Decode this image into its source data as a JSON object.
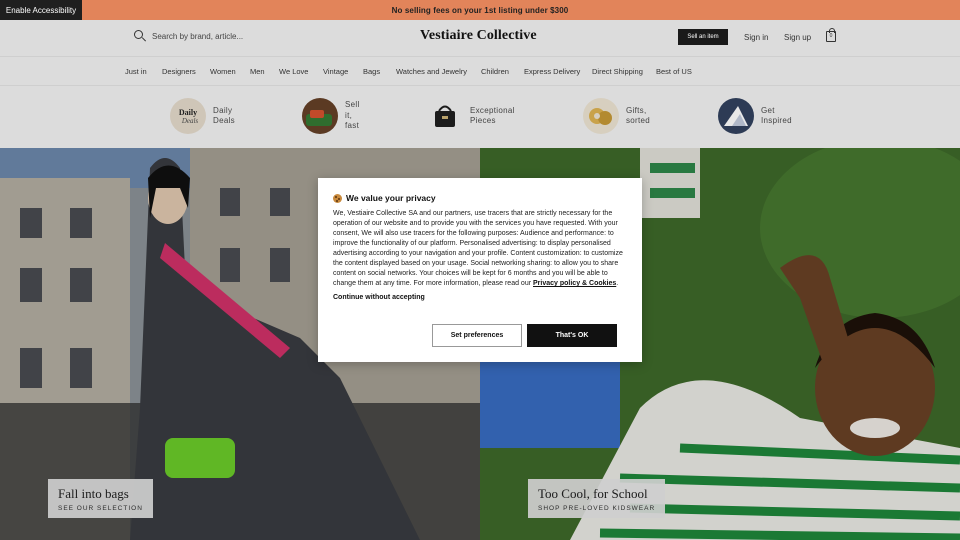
{
  "accessibility": {
    "label": "Enable Accessibility"
  },
  "promo": {
    "text": "No selling fees on your 1st listing under $300",
    "color": "#e2845a"
  },
  "header": {
    "search_placeholder": "Search by brand, article...",
    "logo": "Vestiaire Collective",
    "sell_label": "Sell an item",
    "sign_in": "Sign in",
    "sign_up": "Sign up",
    "bag_count": "0"
  },
  "nav": {
    "items": [
      "Just in",
      "Designers",
      "Women",
      "Men",
      "We Love",
      "Vintage",
      "Bags",
      "Watches and Jewelry",
      "Children",
      "Express Delivery",
      "Direct Shipping",
      "Best of US"
    ]
  },
  "categories": [
    {
      "label_lines": [
        "Daily",
        "Deals"
      ],
      "icon": "daily-deals-icon"
    },
    {
      "label_lines": [
        "Sell",
        "it,",
        "fast"
      ],
      "icon": "sell-icon"
    },
    {
      "label_lines": [
        "Exceptional",
        "Pieces"
      ],
      "icon": "exceptional-icon"
    },
    {
      "label_lines": [
        "Gifts,",
        "sorted"
      ],
      "icon": "gifts-icon"
    },
    {
      "label_lines": [
        "Get",
        "Inspired"
      ],
      "icon": "inspired-icon"
    }
  ],
  "hero": {
    "left": {
      "title": "Fall into bags",
      "subtitle": "SEE OUR SELECTION"
    },
    "right": {
      "title": "Too Cool, for School",
      "subtitle": "SHOP PRE-LOVED KIDSWEAR"
    }
  },
  "consent": {
    "title": "We value your privacy",
    "body": "We, Vestiaire Collective SA and our partners, use tracers that are strictly necessary for the operation of our website and to provide you with the services you have requested. With your consent, We will also use tracers for the following purposes: Audience and performance: to improve the functionality of our platform. Personalised advertising: to display personalised advertising according to your navigation and your profile. Content customization: to customize the content displayed based on your usage. Social networking sharing: to allow you to share content on social networks. Your choices will be kept for 6 months and you will be able to change them at any time. For more information, please read our ",
    "privacy_link": "Privacy policy & Cookies",
    "period": ".",
    "continue": "Continue without accepting",
    "set_preferences": "Set preferences",
    "accept": "That's OK"
  }
}
